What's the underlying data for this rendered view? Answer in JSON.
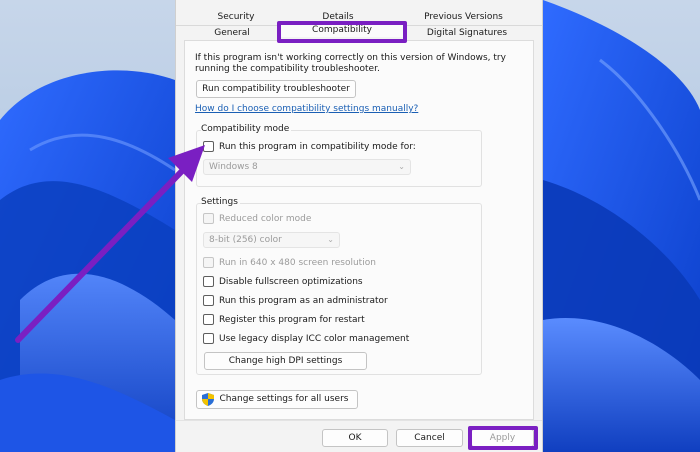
{
  "tabs": {
    "row1": [
      "Security",
      "Details",
      "Previous Versions"
    ],
    "row2": [
      "General",
      "Compatibility",
      "Digital Signatures"
    ]
  },
  "panel": {
    "intro_line1": "If this program isn't working correctly on this version of Windows, try",
    "intro_line2": "running the compatibility troubleshooter.",
    "troubleshooter_button": "Run compatibility troubleshooter",
    "help_link": "How do I choose compatibility settings manually?",
    "compat_mode": {
      "title": "Compatibility mode",
      "checkbox_label": "Run this program in compatibility mode for:",
      "os_selected": "Windows 8"
    },
    "settings": {
      "title": "Settings",
      "reduced_color": "Reduced color mode",
      "color_selected": "8-bit (256) color",
      "run_640": "Run in 640 x 480 screen resolution",
      "disable_fullscreen": "Disable fullscreen optimizations",
      "run_admin": "Run this program as an administrator",
      "register_restart": "Register this program for restart",
      "legacy_icc": "Use legacy display ICC color management",
      "high_dpi_button": "Change high DPI settings"
    },
    "all_users_button": "Change settings for all users"
  },
  "footer": {
    "ok": "OK",
    "cancel": "Cancel",
    "apply": "Apply"
  },
  "colors": {
    "highlight": "#7a1fc2",
    "link": "#1a5fb4"
  }
}
